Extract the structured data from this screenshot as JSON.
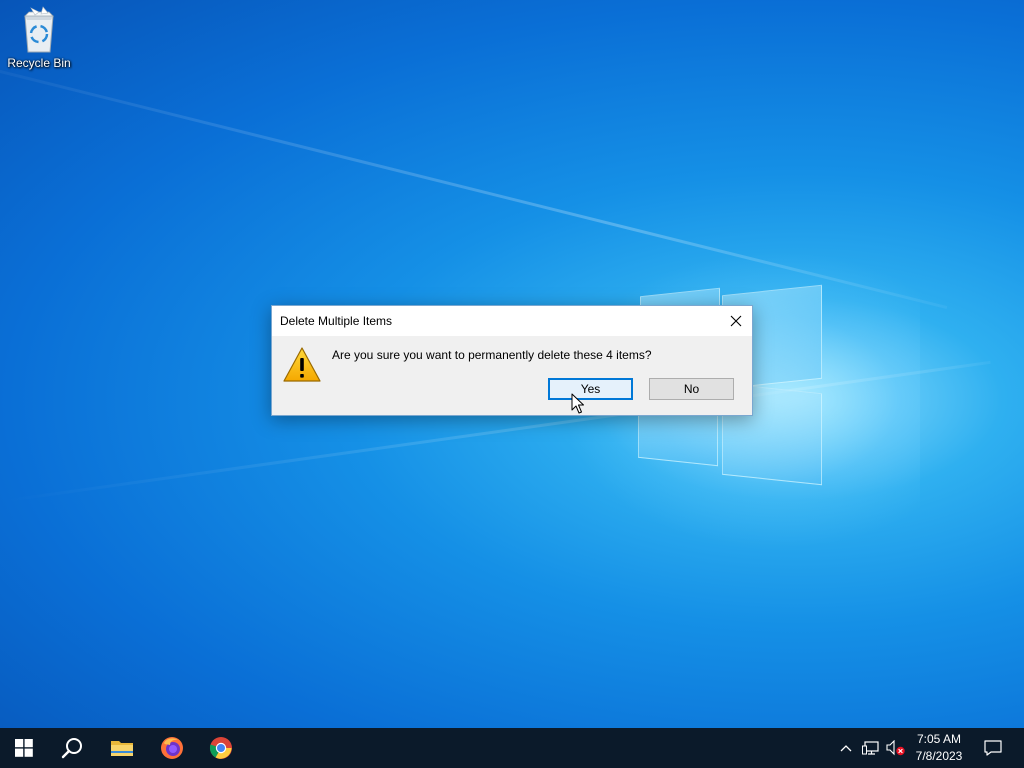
{
  "desktop": {
    "icons": [
      {
        "label": "Recycle Bin",
        "icon": "recycle-bin-icon"
      }
    ]
  },
  "dialog": {
    "title": "Delete Multiple Items",
    "message": "Are you sure you want to permanently delete these 4 items?",
    "icon": "warning-icon",
    "buttons": {
      "yes": "Yes",
      "no": "No"
    },
    "default_button": "yes"
  },
  "taskbar": {
    "pinned": [
      {
        "name": "Start",
        "icon": "windows-start-icon"
      },
      {
        "name": "Search",
        "icon": "search-icon"
      },
      {
        "name": "File Explorer",
        "icon": "folder-icon"
      },
      {
        "name": "Firefox",
        "icon": "firefox-icon"
      },
      {
        "name": "Chrome",
        "icon": "chrome-icon"
      }
    ],
    "tray": {
      "icons": [
        "chevron-up-icon",
        "network-icon",
        "volume-muted-icon"
      ],
      "time": "7:05 AM",
      "date": "7/8/2023",
      "notification_icon": "notification-icon"
    }
  },
  "colors": {
    "accent": "#0078d7",
    "taskbar": "#0b1a2a",
    "dialog_bg": "#f0f0f0"
  }
}
